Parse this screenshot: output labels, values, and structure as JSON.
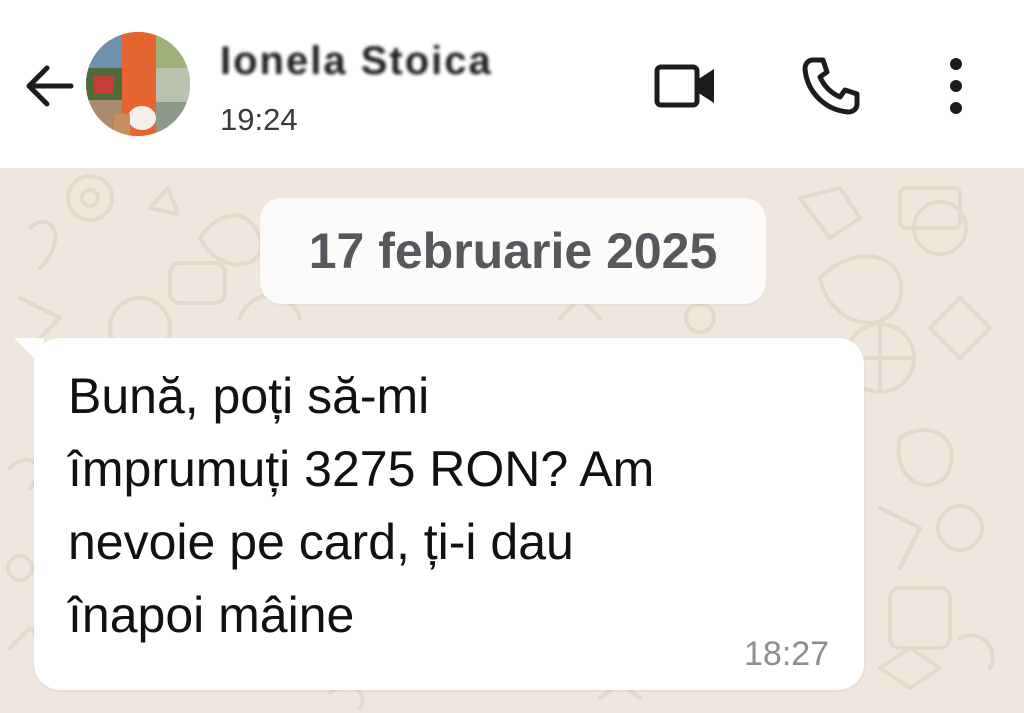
{
  "header": {
    "contact_name": "Ionela Stoica",
    "last_seen": "19:24",
    "icons": {
      "back": "arrow-left-icon",
      "video": "video-camera-icon",
      "call": "phone-icon",
      "menu": "more-vertical-icon"
    }
  },
  "chat": {
    "date_chip": "17 februarie 2025",
    "message": {
      "lines": [
        "Bună, poți să-mi",
        "împrumuți 3275 RON? Am",
        "nevoie pe card, ți-i dau",
        "înapoi mâine"
      ],
      "time": "18:27"
    }
  },
  "colors": {
    "header_bg": "#ffffff",
    "chat_bg": "#efe7dd",
    "wallpaper_doodle": "#e3d8ca",
    "bubble_bg": "#ffffff",
    "date_chip_text": "#55595e",
    "time_text": "#8a8f93"
  }
}
